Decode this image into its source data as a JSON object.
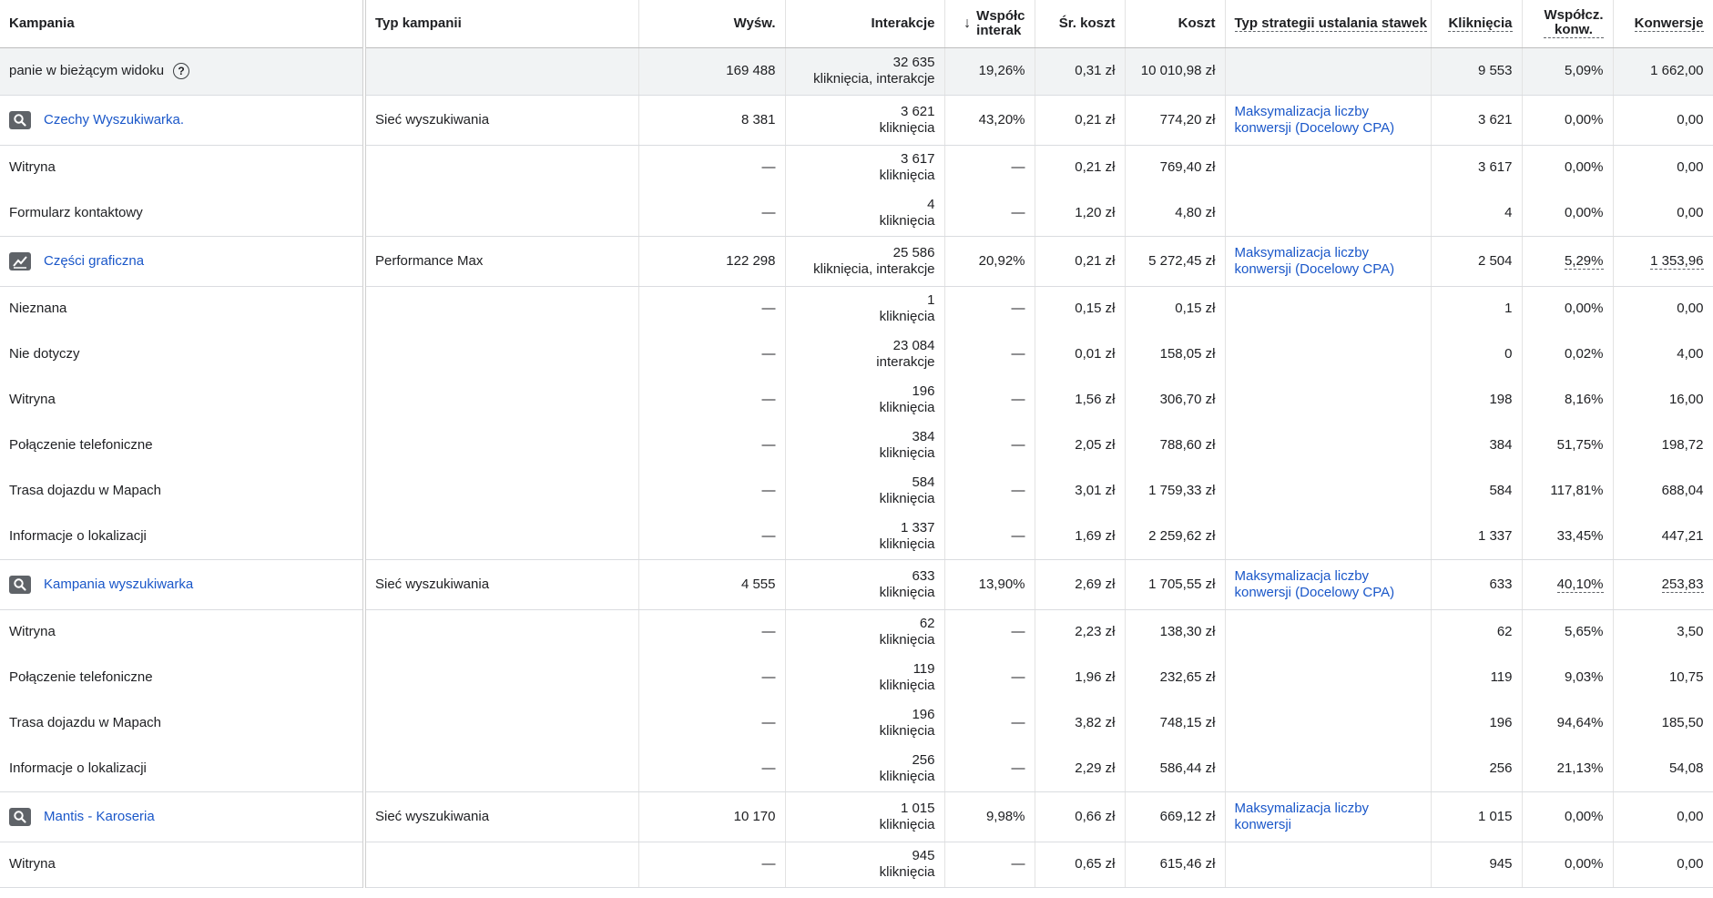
{
  "columns": {
    "kampania": "Kampania",
    "typ": "Typ kampanii",
    "wysw": "Wyśw.",
    "interakcje": "Interakcje",
    "wspol_line1": "Współc",
    "wspol_line2": "interak",
    "sr_koszt": "Śr. koszt",
    "koszt": "Koszt",
    "strategia": "Typ strategii ustalania stawek",
    "klikniecia": "Kliknięcia",
    "wspol_konw_line1": "Współcz.",
    "wspol_konw_line2": "konw.",
    "konwersje": "Konwersje"
  },
  "total": {
    "label": "panie w bieżącym widoku",
    "wysw": "169 488",
    "interakcje_value": "32 635",
    "interakcje_unit": "kliknięcia, interakcje",
    "wspol": "19,26%",
    "sr_koszt": "0,31 zł",
    "koszt": "10 010,98 zł",
    "klikniecia": "9 553",
    "wspol_konw": "5,09%",
    "konwersje": "1 662,00"
  },
  "campaigns": [
    {
      "icon": "search-icon",
      "name": "Czechy Wyszukiwarka.",
      "typ": "Sieć wyszukiwania",
      "wysw": "8 381",
      "interakcje_value": "3 621",
      "interakcje_unit": "kliknięcia",
      "wspol": "43,20%",
      "sr_koszt": "0,21 zł",
      "koszt": "774,20 zł",
      "strategia_line1": "Maksymalizacja liczby",
      "strategia_line2": "konwersji (Docelowy CPA)",
      "klikniecia": "3 621",
      "wspol_konw": "0,00%",
      "konwersje": "0,00",
      "subs": [
        {
          "label": "Witryna",
          "wysw": "—",
          "interakcje_value": "3 617",
          "interakcje_unit": "kliknięcia",
          "wspol": "—",
          "sr_koszt": "0,21 zł",
          "koszt": "769,40 zł",
          "klikniecia": "3 617",
          "wspol_konw": "0,00%",
          "konwersje": "0,00"
        },
        {
          "label": "Formularz kontaktowy",
          "wysw": "—",
          "interakcje_value": "4",
          "interakcje_unit": "kliknięcia",
          "wspol": "—",
          "sr_koszt": "1,20 zł",
          "koszt": "4,80 zł",
          "klikniecia": "4",
          "wspol_konw": "0,00%",
          "konwersje": "0,00"
        }
      ]
    },
    {
      "icon": "trend-chart-icon",
      "name": "Części graficzna",
      "typ": "Performance Max",
      "wysw": "122 298",
      "interakcje_value": "25 586",
      "interakcje_unit": "kliknięcia, interakcje",
      "wspol": "20,92%",
      "sr_koszt": "0,21 zł",
      "koszt": "5 272,45 zł",
      "strategia_line1": "Maksymalizacja liczby",
      "strategia_line2": "konwersji (Docelowy CPA)",
      "klikniecia": "2 504",
      "wspol_konw": "5,29%",
      "konwersje": "1 353,96",
      "subs": [
        {
          "label": "Nieznana",
          "wysw": "—",
          "interakcje_value": "1",
          "interakcje_unit": "kliknięcia",
          "wspol": "—",
          "sr_koszt": "0,15 zł",
          "koszt": "0,15 zł",
          "klikniecia": "1",
          "wspol_konw": "0,00%",
          "konwersje": "0,00"
        },
        {
          "label": "Nie dotyczy",
          "wysw": "—",
          "interakcje_value": "23 084",
          "interakcje_unit": "interakcje",
          "wspol": "—",
          "sr_koszt": "0,01 zł",
          "koszt": "158,05 zł",
          "klikniecia": "0",
          "wspol_konw": "0,02%",
          "konwersje": "4,00"
        },
        {
          "label": "Witryna",
          "wysw": "—",
          "interakcje_value": "196",
          "interakcje_unit": "kliknięcia",
          "wspol": "—",
          "sr_koszt": "1,56 zł",
          "koszt": "306,70 zł",
          "klikniecia": "198",
          "wspol_konw": "8,16%",
          "konwersje": "16,00"
        },
        {
          "label": "Połączenie telefoniczne",
          "wysw": "—",
          "interakcje_value": "384",
          "interakcje_unit": "kliknięcia",
          "wspol": "—",
          "sr_koszt": "2,05 zł",
          "koszt": "788,60 zł",
          "klikniecia": "384",
          "wspol_konw": "51,75%",
          "konwersje": "198,72"
        },
        {
          "label": "Trasa dojazdu w Mapach",
          "wysw": "—",
          "interakcje_value": "584",
          "interakcje_unit": "kliknięcia",
          "wspol": "—",
          "sr_koszt": "3,01 zł",
          "koszt": "1 759,33 zł",
          "klikniecia": "584",
          "wspol_konw": "117,81%",
          "konwersje": "688,04"
        },
        {
          "label": "Informacje o lokalizacji",
          "wysw": "—",
          "interakcje_value": "1 337",
          "interakcje_unit": "kliknięcia",
          "wspol": "—",
          "sr_koszt": "1,69 zł",
          "koszt": "2 259,62 zł",
          "klikniecia": "1 337",
          "wspol_konw": "33,45%",
          "konwersje": "447,21"
        }
      ]
    },
    {
      "icon": "search-icon",
      "name": "Kampania wyszukiwarka",
      "typ": "Sieć wyszukiwania",
      "wysw": "4 555",
      "interakcje_value": "633",
      "interakcje_unit": "kliknięcia",
      "wspol": "13,90%",
      "sr_koszt": "2,69 zł",
      "koszt": "1 705,55 zł",
      "strategia_line1": "Maksymalizacja liczby",
      "strategia_line2": "konwersji (Docelowy CPA)",
      "klikniecia": "633",
      "wspol_konw": "40,10%",
      "konwersje": "253,83",
      "subs": [
        {
          "label": "Witryna",
          "wysw": "—",
          "interakcje_value": "62",
          "interakcje_unit": "kliknięcia",
          "wspol": "—",
          "sr_koszt": "2,23 zł",
          "koszt": "138,30 zł",
          "klikniecia": "62",
          "wspol_konw": "5,65%",
          "konwersje": "3,50"
        },
        {
          "label": "Połączenie telefoniczne",
          "wysw": "—",
          "interakcje_value": "119",
          "interakcje_unit": "kliknięcia",
          "wspol": "—",
          "sr_koszt": "1,96 zł",
          "koszt": "232,65 zł",
          "klikniecia": "119",
          "wspol_konw": "9,03%",
          "konwersje": "10,75"
        },
        {
          "label": "Trasa dojazdu w Mapach",
          "wysw": "—",
          "interakcje_value": "196",
          "interakcje_unit": "kliknięcia",
          "wspol": "—",
          "sr_koszt": "3,82 zł",
          "koszt": "748,15 zł",
          "klikniecia": "196",
          "wspol_konw": "94,64%",
          "konwersje": "185,50"
        },
        {
          "label": "Informacje o lokalizacji",
          "wysw": "—",
          "interakcje_value": "256",
          "interakcje_unit": "kliknięcia",
          "wspol": "—",
          "sr_koszt": "2,29 zł",
          "koszt": "586,44 zł",
          "klikniecia": "256",
          "wspol_konw": "21,13%",
          "konwersje": "54,08"
        }
      ]
    },
    {
      "icon": "search-icon",
      "name": "Mantis - Karoseria",
      "typ": "Sieć wyszukiwania",
      "wysw": "10 170",
      "interakcje_value": "1 015",
      "interakcje_unit": "kliknięcia",
      "wspol": "9,98%",
      "sr_koszt": "0,66 zł",
      "koszt": "669,12 zł",
      "strategia_line1": "Maksymalizacja liczby",
      "strategia_line2": "konwersji",
      "klikniecia": "1 015",
      "wspol_konw": "0,00%",
      "konwersje": "0,00",
      "subs": [
        {
          "label": "Witryna",
          "wysw": "—",
          "interakcje_value": "945",
          "interakcje_unit": "kliknięcia",
          "wspol": "—",
          "sr_koszt": "0,65 zł",
          "koszt": "615,46 zł",
          "klikniecia": "945",
          "wspol_konw": "0,00%",
          "konwersje": "0,00"
        }
      ]
    }
  ]
}
